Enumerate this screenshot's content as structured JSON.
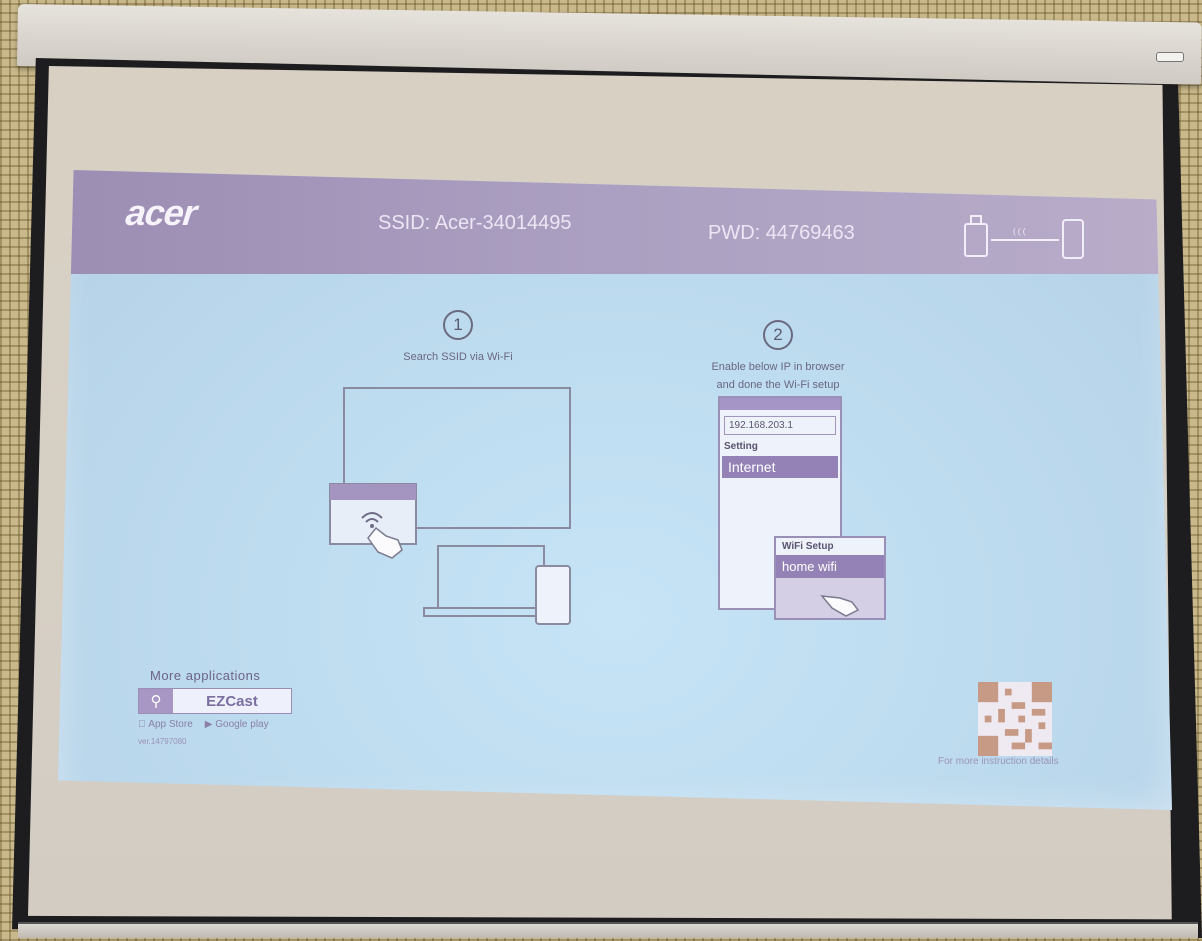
{
  "header": {
    "brand": "acer",
    "ssid": "SSID:  Acer-34014495",
    "pwd": "PWD: 44769463"
  },
  "steps": [
    {
      "number": "1",
      "text": "Search SSID via Wi-Fi"
    },
    {
      "number": "2",
      "text_line1": "Enable below IP in browser",
      "text_line2": "and done the Wi-Fi setup"
    }
  ],
  "browser": {
    "address": "192.168.203.1",
    "setting": "Setting",
    "internet": "Internet",
    "wifi_setup": "WiFi Setup",
    "home_wifi": "home wifi"
  },
  "footer": {
    "more_apps": "More applications",
    "app_name": "EZCast",
    "app_store": "App Store",
    "google_play": "Google play",
    "version": "ver.14797080",
    "qr_caption": "For more instruction details"
  },
  "icons": [
    "search-icon",
    "wifi-icon",
    "pointing-hand-icon",
    "qr-code-icon",
    "dongle-icon",
    "phone-icon"
  ]
}
